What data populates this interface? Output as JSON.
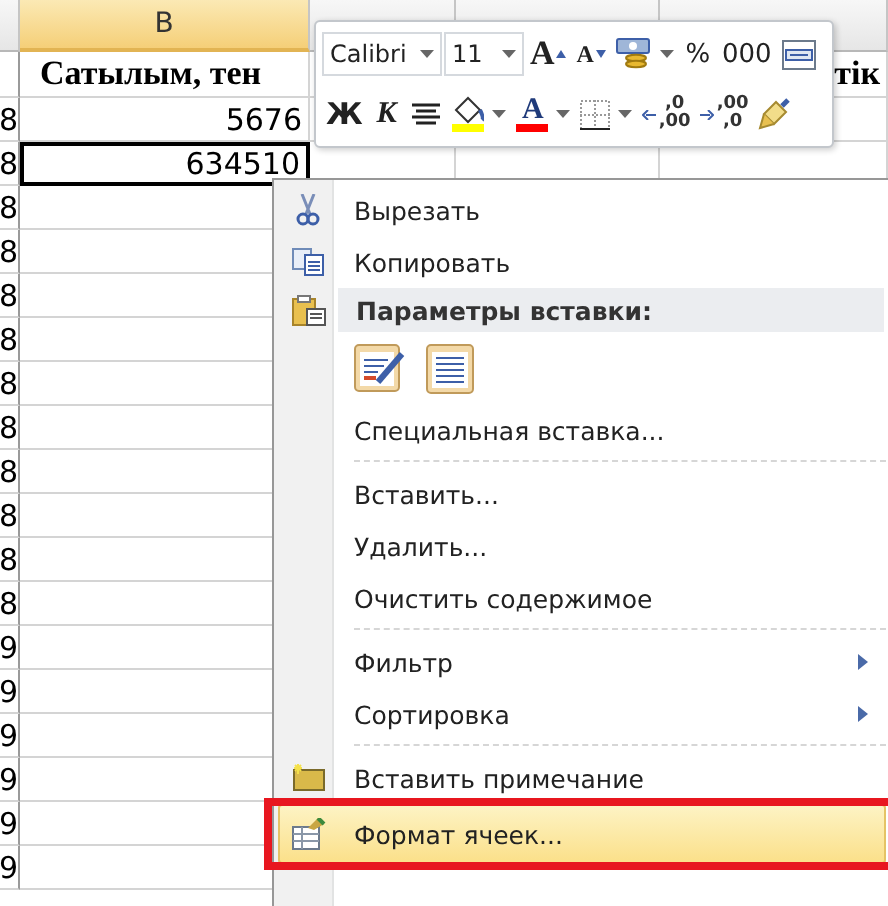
{
  "sheet": {
    "column_headers": [
      {
        "label": "B",
        "selected": true
      }
    ],
    "header_row": {
      "column_b": "Сатылым, тен",
      "column_e": "тік"
    },
    "rows": [
      {
        "column_a": "8",
        "column_b": "5676",
        "selected": false
      },
      {
        "column_a": "8",
        "column_b": "634510",
        "selected": true
      },
      {
        "column_a": "8",
        "selected": false
      },
      {
        "column_a": "8",
        "selected": false
      },
      {
        "column_a": "8",
        "selected": false
      },
      {
        "column_a": "8",
        "selected": false
      },
      {
        "column_a": "8",
        "selected": false
      },
      {
        "column_a": "8",
        "selected": false
      },
      {
        "column_a": "8",
        "selected": false
      },
      {
        "column_a": "8",
        "selected": false
      },
      {
        "column_a": "8",
        "selected": false
      },
      {
        "column_a": "8",
        "selected": false
      },
      {
        "column_a": "9",
        "selected": false
      },
      {
        "column_a": "9",
        "selected": false
      },
      {
        "column_a": "9",
        "selected": false
      },
      {
        "column_a": "9",
        "selected": false
      },
      {
        "column_a": "9",
        "selected": false
      },
      {
        "column_a": "9",
        "selected": false
      }
    ]
  },
  "mini_toolbar": {
    "top_row": [
      {
        "kind": "font-field",
        "value": "Calibri"
      },
      {
        "kind": "size-field",
        "value": "11"
      },
      {
        "kind": "grow-font",
        "label": "A"
      },
      {
        "kind": "shrink-font",
        "label": "A"
      },
      {
        "kind": "currency",
        "dropdown": true
      },
      {
        "kind": "text",
        "label": "%"
      },
      {
        "kind": "text",
        "label": "000"
      },
      {
        "kind": "merge"
      }
    ],
    "bottom_row": [
      {
        "kind": "bold",
        "label": "Ж"
      },
      {
        "kind": "italic",
        "label": "К"
      },
      {
        "kind": "align-center"
      },
      {
        "kind": "fill-color",
        "color": "#ffff00",
        "dropdown": true
      },
      {
        "kind": "font-color",
        "label": "A",
        "color": "#ff0000",
        "dropdown": true
      },
      {
        "kind": "borders",
        "dropdown": true
      },
      {
        "kind": "increase-decimal",
        "top": ",0",
        "bottom": ",00"
      },
      {
        "kind": "decrease-decimal",
        "top": ",00",
        "bottom": ",0"
      },
      {
        "kind": "format-painter"
      }
    ]
  },
  "menu": {
    "items": [
      {
        "kind": "cut",
        "label": "Вырезать",
        "selected": false,
        "submenu": false,
        "framed": false
      },
      {
        "kind": "copy",
        "label": "Копировать",
        "selected": false,
        "submenu": false,
        "framed": false
      },
      {
        "kind": "paste-header",
        "label": "Параметры вставки:"
      },
      {
        "kind": "paste-options"
      },
      {
        "kind": "command",
        "label": "Специальная вставка...",
        "selected": false,
        "submenu": false,
        "framed": false
      },
      {
        "kind": "separator"
      },
      {
        "kind": "command",
        "label": "Вставить...",
        "selected": false,
        "submenu": false,
        "framed": false
      },
      {
        "kind": "command",
        "label": "Удалить...",
        "selected": false,
        "submenu": false,
        "framed": false
      },
      {
        "kind": "command",
        "label": "Очистить содержимое",
        "selected": false,
        "submenu": false,
        "framed": false
      },
      {
        "kind": "separator"
      },
      {
        "kind": "command",
        "label": "Фильтр",
        "selected": false,
        "submenu": true,
        "framed": false
      },
      {
        "kind": "command",
        "label": "Сортировка",
        "selected": false,
        "submenu": true,
        "framed": false
      },
      {
        "kind": "separator"
      },
      {
        "kind": "comment",
        "label": "Вставить примечание",
        "selected": false,
        "submenu": false,
        "framed": false
      },
      {
        "kind": "format",
        "label": "Формат ячеек...",
        "selected": true,
        "submenu": false,
        "framed": true
      }
    ]
  }
}
